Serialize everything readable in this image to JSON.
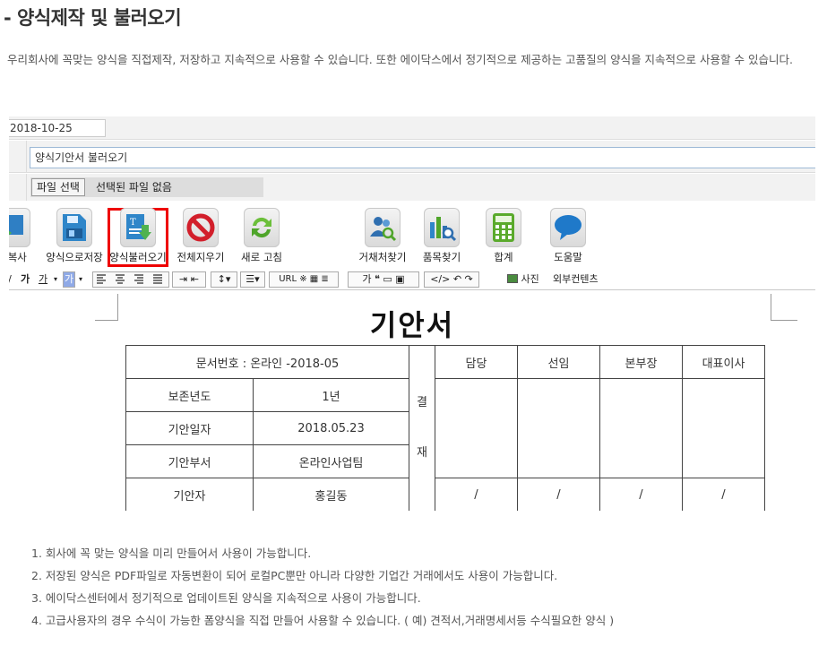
{
  "page": {
    "heading": "- 양식제작 및 불러오기",
    "intro": "우리회사에 꼭맞는 양식을 직접제작, 저장하고 지속적으로 사용할 수 있습니다. 또한 에이닥스에서 정기적으로 제공하는 고품질의 양식을 지속적으로 사용할 수 있습니다."
  },
  "editor": {
    "date_value": "2018-10-25",
    "title_value": "양식기안서 불러오기",
    "file_button": "파일 선택",
    "file_status": "선택된 파일 없음",
    "tools": [
      {
        "label": "서복사",
        "icon": "copy-icon"
      },
      {
        "label": "양식으로저장",
        "icon": "save-form-icon"
      },
      {
        "label": "양식불러오기",
        "icon": "load-form-icon"
      },
      {
        "label": "전체지우기",
        "icon": "clear-all-icon"
      },
      {
        "label": "새로 고침",
        "icon": "refresh-icon"
      },
      {
        "label": "거채처찾기",
        "icon": "client-search-icon"
      },
      {
        "label": "품목찾기",
        "icon": "item-search-icon"
      },
      {
        "label": "합계",
        "icon": "calculator-icon"
      },
      {
        "label": "도움말",
        "icon": "help-icon"
      }
    ],
    "format": {
      "ga_bold": "가",
      "ga_underline": "가",
      "ga_color": "가",
      "url": "URL",
      "special": "※",
      "photo": "사진",
      "external": "외부컨텐츠"
    },
    "accent_color": "#e00000"
  },
  "document": {
    "title": "기안서",
    "doc_number": "문서번호 : 온라인 -2018-05",
    "rows": [
      {
        "label": "보존년도",
        "value": "1년"
      },
      {
        "label": "기안일자",
        "value": "2018.05.23"
      },
      {
        "label": "기안부서",
        "value": "온라인사업팀"
      },
      {
        "label": "기안자",
        "value": "홍길동"
      }
    ],
    "approval_label_1": "결",
    "approval_label_2": "재",
    "approvers": [
      "담당",
      "선임",
      "본부장",
      "대표이사"
    ],
    "slash": "/"
  },
  "notes": [
    "1. 회사에 꼭 맞는 양식을 미리 만들어서 사용이 가능합니다.",
    "2. 저장된 양식은 PDF파일로 자동변환이 되어 로컬PC뿐만 아니라 다양한 기업간 거래에서도 사용이 가능합니다.",
    "3. 에이닥스센터에서 정기적으로 업데이트된 양식을 지속적으로 사용이 가능합니다.",
    "4. 고급사용자의 경우 수식이 가능한 폼양식을 직접 만들어 사용할 수 있습니다. ( 예) 견적서,거래명세서등 수식필요한 양식 )"
  ]
}
